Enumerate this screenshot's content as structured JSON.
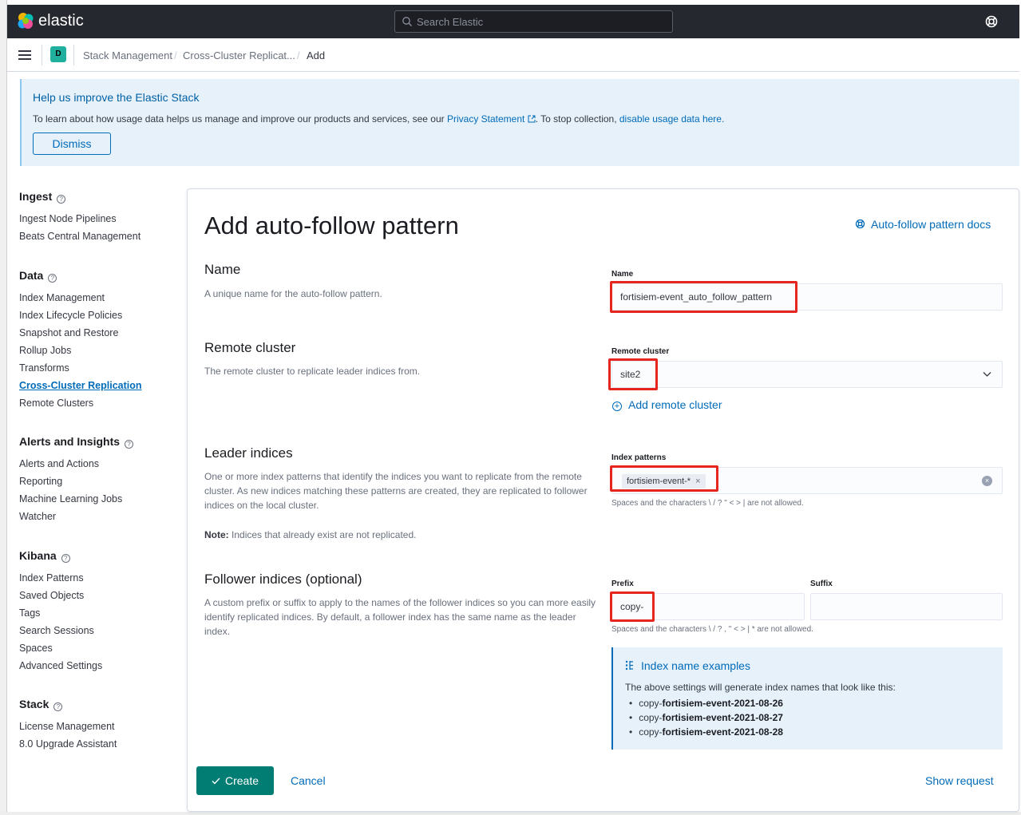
{
  "header": {
    "logo_text": "elastic",
    "search_placeholder": "Search Elastic"
  },
  "breadcrumbs": {
    "space_initial": "D",
    "items": [
      "Stack Management",
      "Cross-Cluster Replicat...",
      "Add"
    ]
  },
  "callout": {
    "title": "Help us improve the Elastic Stack",
    "body_prefix": "To learn about how usage data helps us manage and improve our products and services, see our ",
    "privacy_link": "Privacy Statement",
    "body_middle": ". To stop collection, ",
    "disable_link": "disable usage data here.",
    "dismiss_label": "Dismiss"
  },
  "sidebar": {
    "groups": [
      {
        "title": "Ingest",
        "items": [
          "Ingest Node Pipelines",
          "Beats Central Management"
        ]
      },
      {
        "title": "Data",
        "items": [
          "Index Management",
          "Index Lifecycle Policies",
          "Snapshot and Restore",
          "Rollup Jobs",
          "Transforms",
          "Cross-Cluster Replication",
          "Remote Clusters"
        ]
      },
      {
        "title": "Alerts and Insights",
        "items": [
          "Alerts and Actions",
          "Reporting",
          "Machine Learning Jobs",
          "Watcher"
        ]
      },
      {
        "title": "Kibana",
        "items": [
          "Index Patterns",
          "Saved Objects",
          "Tags",
          "Search Sessions",
          "Spaces",
          "Advanced Settings"
        ]
      },
      {
        "title": "Stack",
        "items": [
          "License Management",
          "8.0 Upgrade Assistant"
        ]
      }
    ],
    "active_item": "Cross-Cluster Replication"
  },
  "main": {
    "title": "Add auto-follow pattern",
    "docs_link": "Auto-follow pattern docs",
    "name_section": {
      "title": "Name",
      "description": "A unique name for the auto-follow pattern.",
      "field_label": "Name",
      "value": "fortisiem-event_auto_follow_pattern"
    },
    "remote_section": {
      "title": "Remote cluster",
      "description": "The remote cluster to replicate leader indices from.",
      "field_label": "Remote cluster",
      "value": "site2",
      "add_link": "Add remote cluster"
    },
    "leader_section": {
      "title": "Leader indices",
      "description": "One or more index patterns that identify the indices you want to replicate from the remote cluster. As new indices matching these patterns are created, they are replicated to follower indices on the local cluster.",
      "note_label": "Note:",
      "note_text": " Indices that already exist are not replicated.",
      "field_label": "Index patterns",
      "pattern": "fortisiem-event-*",
      "help": "Spaces and the characters \\ / ? \" < > | are not allowed."
    },
    "follower_section": {
      "title": "Follower indices (optional)",
      "description": "A custom prefix or suffix to apply to the names of the follower indices so you can more easily identify replicated indices. By default, a follower index has the same name as the leader index.",
      "prefix_label": "Prefix",
      "prefix_value": "copy-",
      "suffix_label": "Suffix",
      "suffix_value": "",
      "help": "Spaces and the characters \\ / ? , \" < > | * are not allowed."
    },
    "examples": {
      "title": "Index name examples",
      "intro": "The above settings will generate index names that look like this:",
      "prefix": "copy-",
      "names": [
        "fortisiem-event-2021-08-26",
        "fortisiem-event-2021-08-27",
        "fortisiem-event-2021-08-28"
      ]
    },
    "create_label": "Create",
    "cancel_label": "Cancel",
    "show_request_label": "Show request"
  },
  "colors": {
    "header_bg": "#25282f",
    "accent": "#006bb8",
    "primary_button": "#017d73",
    "highlight": "#e6251f",
    "callout_bg": "#e6f1fa"
  }
}
